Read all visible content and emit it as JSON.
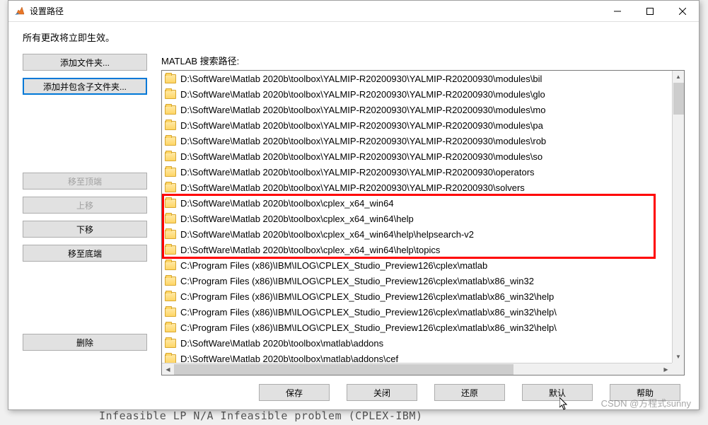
{
  "window": {
    "title": "设置路径"
  },
  "notice": "所有更改将立即生效。",
  "leftButtons": {
    "addFolder": "添加文件夹...",
    "addWithSub": "添加并包含子文件夹...",
    "moveTop": "移至顶端",
    "moveUp": "上移",
    "moveDown": "下移",
    "moveBottom": "移至底端",
    "delete": "删除"
  },
  "listLabel": "MATLAB 搜索路径:",
  "paths": [
    "D:\\SoftWare\\Matlab 2020b\\toolbox\\YALMIP-R20200930\\YALMIP-R20200930\\modules\\bil",
    "D:\\SoftWare\\Matlab 2020b\\toolbox\\YALMIP-R20200930\\YALMIP-R20200930\\modules\\glo",
    "D:\\SoftWare\\Matlab 2020b\\toolbox\\YALMIP-R20200930\\YALMIP-R20200930\\modules\\mo",
    "D:\\SoftWare\\Matlab 2020b\\toolbox\\YALMIP-R20200930\\YALMIP-R20200930\\modules\\pa",
    "D:\\SoftWare\\Matlab 2020b\\toolbox\\YALMIP-R20200930\\YALMIP-R20200930\\modules\\rob",
    "D:\\SoftWare\\Matlab 2020b\\toolbox\\YALMIP-R20200930\\YALMIP-R20200930\\modules\\so",
    "D:\\SoftWare\\Matlab 2020b\\toolbox\\YALMIP-R20200930\\YALMIP-R20200930\\operators",
    "D:\\SoftWare\\Matlab 2020b\\toolbox\\YALMIP-R20200930\\YALMIP-R20200930\\solvers",
    "D:\\SoftWare\\Matlab 2020b\\toolbox\\cplex_x64_win64",
    "D:\\SoftWare\\Matlab 2020b\\toolbox\\cplex_x64_win64\\help",
    "D:\\SoftWare\\Matlab 2020b\\toolbox\\cplex_x64_win64\\help\\helpsearch-v2",
    "D:\\SoftWare\\Matlab 2020b\\toolbox\\cplex_x64_win64\\help\\topics",
    "C:\\Program Files (x86)\\IBM\\ILOG\\CPLEX_Studio_Preview126\\cplex\\matlab",
    "C:\\Program Files (x86)\\IBM\\ILOG\\CPLEX_Studio_Preview126\\cplex\\matlab\\x86_win32",
    "C:\\Program Files (x86)\\IBM\\ILOG\\CPLEX_Studio_Preview126\\cplex\\matlab\\x86_win32\\help",
    "C:\\Program Files (x86)\\IBM\\ILOG\\CPLEX_Studio_Preview126\\cplex\\matlab\\x86_win32\\help\\",
    "C:\\Program Files (x86)\\IBM\\ILOG\\CPLEX_Studio_Preview126\\cplex\\matlab\\x86_win32\\help\\",
    "D:\\SoftWare\\Matlab 2020b\\toolbox\\matlab\\addons",
    "D:\\SoftWare\\Matlab 2020b\\toolbox\\matlab\\addons\\cef"
  ],
  "footer": {
    "save": "保存",
    "close": "关闭",
    "revert": "还原",
    "default": "默认",
    "help": "帮助"
  },
  "watermark": "CSDN @方程式sunny",
  "bgText": "Infeasible LP            N/A       Infeasible problem (CPLEX-IBM)"
}
